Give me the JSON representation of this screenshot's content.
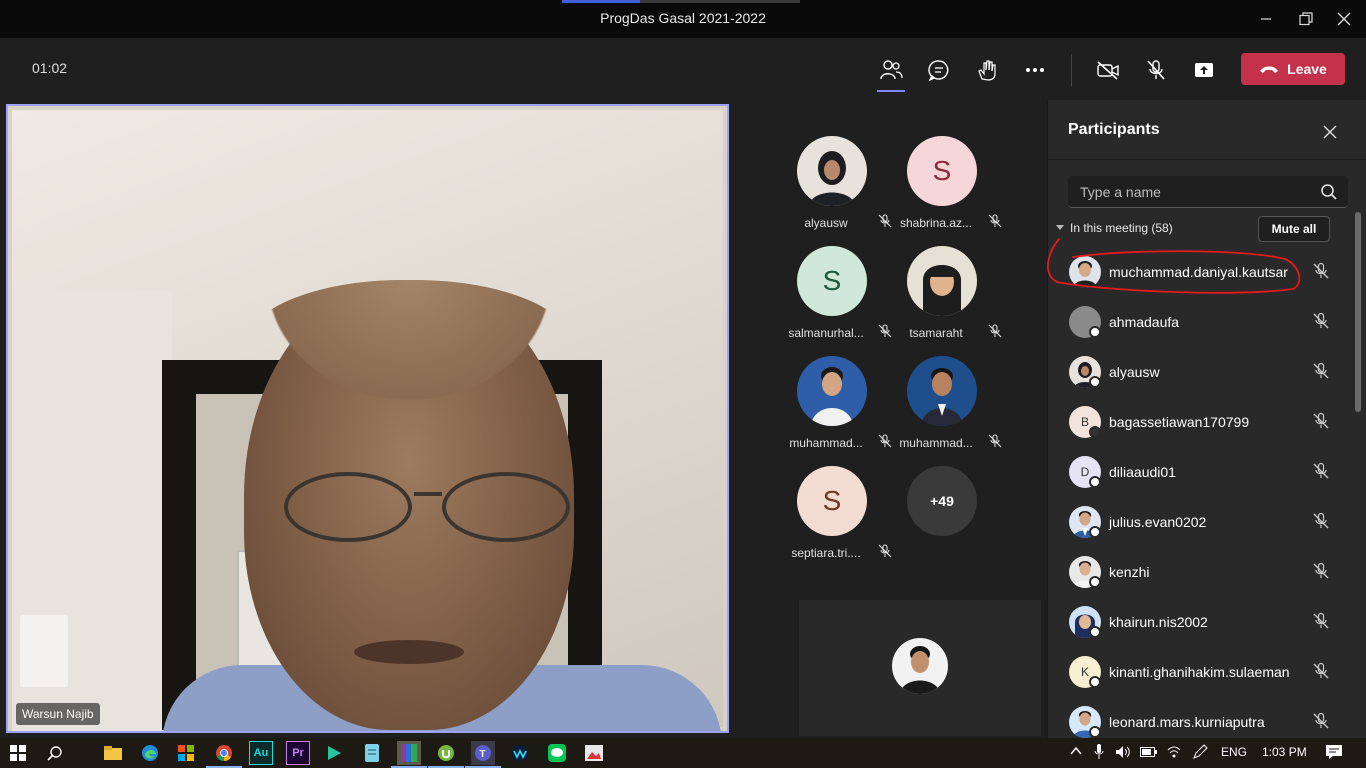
{
  "window": {
    "title": "ProgDas Gasal 2021-2022"
  },
  "toolbar": {
    "timer": "01:02",
    "leave_label": "Leave"
  },
  "stage": {
    "speaker_name": "Warsun Najib"
  },
  "gallery": {
    "tiles": [
      {
        "name": "alyausw",
        "initial": "",
        "bg": "#e7e2dc"
      },
      {
        "name": "shabrina.az...",
        "initial": "S",
        "bg": "#f6d6d8"
      },
      {
        "name": "salmanurhal...",
        "initial": "S",
        "bg": "#cfe8d9"
      },
      {
        "name": "tsamaraht",
        "initial": "",
        "bg": "#e6e1d6"
      },
      {
        "name": "muhammad...",
        "initial": "",
        "bg": "#2f5ea8"
      },
      {
        "name": "muhammad...",
        "initial": "",
        "bg": "#1f4e8c"
      },
      {
        "name": "septiara.tri....",
        "initial": "S",
        "bg": "#f3ddd2"
      }
    ],
    "more_label": "+49"
  },
  "participants": {
    "header": "Participants",
    "search_placeholder": "Type a name",
    "section_label": "In this meeting (58)",
    "mute_all_label": "Mute all",
    "items": [
      {
        "name": "muchammad.daniyal.kautsar",
        "initial": "",
        "bg": "#dfe3ea"
      },
      {
        "name": "ahmadaufa",
        "initial": "",
        "bg": "#8a8a8a"
      },
      {
        "name": "alyausw",
        "initial": "",
        "bg": "#e7e2dc"
      },
      {
        "name": "bagassetiawan170799",
        "initial": "B",
        "bg": "#f3e3dc"
      },
      {
        "name": "diliaaudi01",
        "initial": "D",
        "bg": "#e6e3f5"
      },
      {
        "name": "julius.evan0202",
        "initial": "",
        "bg": "#dfe6f3"
      },
      {
        "name": "kenzhi",
        "initial": "",
        "bg": "#e8e8e8"
      },
      {
        "name": "khairun.nis2002",
        "initial": "",
        "bg": "#cfe1f6"
      },
      {
        "name": "kinanti.ghanihakim.sulaeman",
        "initial": "K",
        "bg": "#f7efcf"
      },
      {
        "name": "leonard.mars.kurniaputra",
        "initial": "",
        "bg": "#d6e8fb"
      }
    ]
  },
  "taskbar": {
    "language": "ENG",
    "time": "1:03 PM"
  },
  "colors": {
    "accent": "#7f85f5",
    "leave": "#c4314b",
    "stage_border": "#9ea2ff",
    "annotation": "#e21b1b"
  }
}
